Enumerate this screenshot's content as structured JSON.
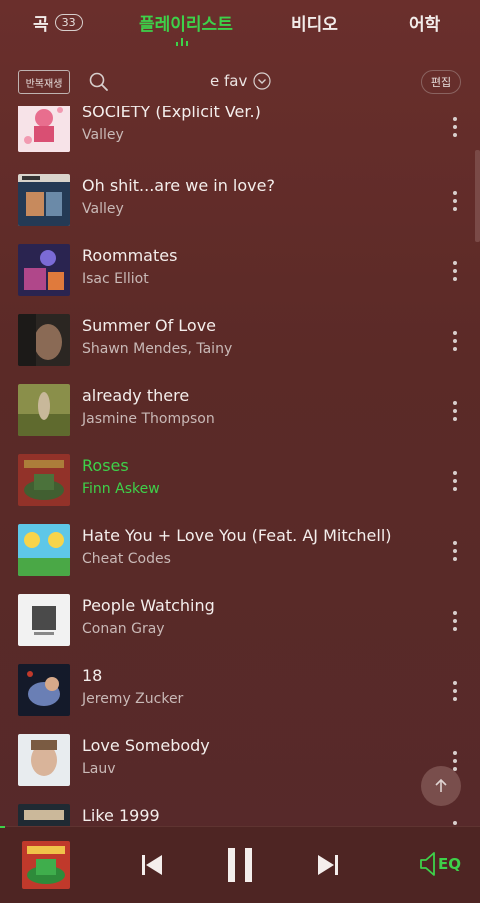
{
  "tabs": {
    "songs_label": "곡",
    "songs_count": "33",
    "playlist_label": "플레이리스트",
    "video_label": "비디오",
    "study_label": "어학",
    "active_color": "#3ed14a"
  },
  "toolbar": {
    "repeat_label": "반복재생",
    "search_icon": "search-icon",
    "playlist_name": "e fav",
    "edit_label": "편집"
  },
  "songs": [
    {
      "title": "SOCIETY (Explicit Ver.)",
      "artist": "Valley",
      "active": false
    },
    {
      "title": "Oh shit...are we in love?",
      "artist": "Valley",
      "active": false
    },
    {
      "title": "Roommates",
      "artist": "Isac Elliot",
      "active": false
    },
    {
      "title": "Summer Of Love",
      "artist": "Shawn Mendes, Tainy",
      "active": false
    },
    {
      "title": "already there",
      "artist": "Jasmine Thompson",
      "active": false
    },
    {
      "title": "Roses",
      "artist": "Finn Askew",
      "active": true
    },
    {
      "title": "Hate You + Love You (Feat. AJ Mitchell)",
      "artist": "Cheat Codes",
      "active": false
    },
    {
      "title": "People Watching",
      "artist": "Conan Gray",
      "active": false
    },
    {
      "title": "18",
      "artist": "Jeremy Zucker",
      "active": false
    },
    {
      "title": "Love Somebody",
      "artist": "Lauv",
      "active": false
    },
    {
      "title": "Like 1999",
      "artist": "",
      "active": false
    }
  ],
  "player": {
    "eq_label": "EQ",
    "progress_fraction": 0.01,
    "state": "playing"
  }
}
